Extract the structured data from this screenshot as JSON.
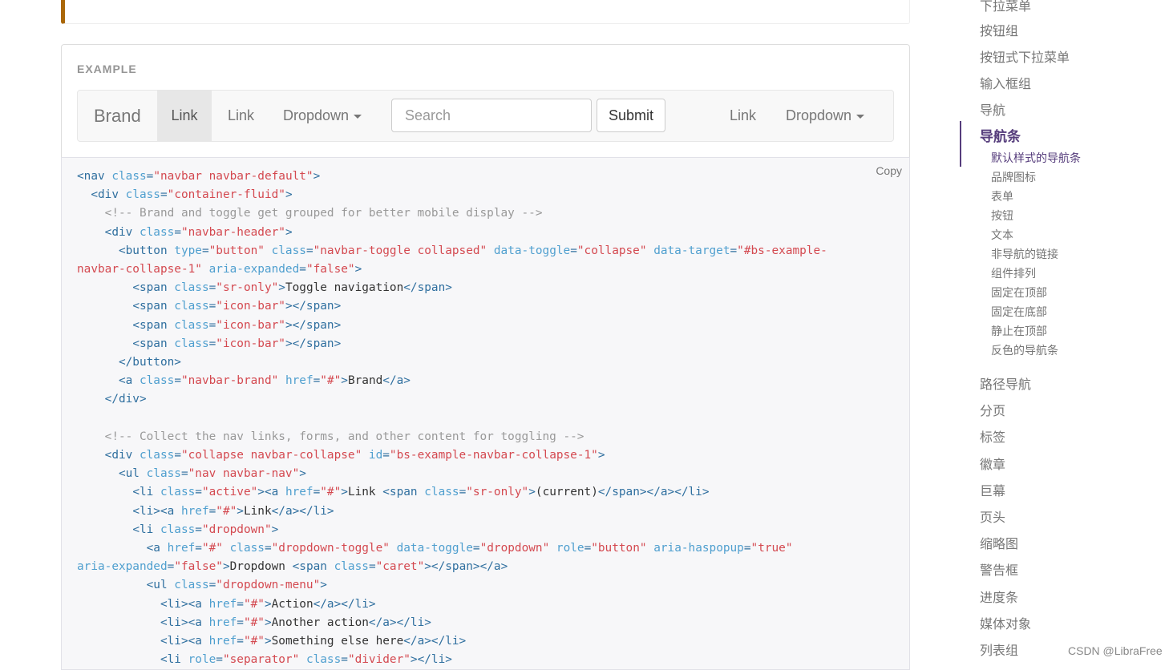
{
  "example": {
    "label": "EXAMPLE",
    "navbar": {
      "brand": "Brand",
      "active_link": "Link",
      "link": "Link",
      "dropdown": "Dropdown",
      "search_placeholder": "Search",
      "submit": "Submit",
      "right_link": "Link",
      "right_dropdown": "Dropdown"
    }
  },
  "code": {
    "copy_label": "Copy",
    "lines": [
      [
        [
          "t",
          "<nav "
        ],
        [
          "a",
          "class"
        ],
        [
          "t",
          "="
        ],
        [
          "s",
          "\"navbar navbar-default\""
        ],
        [
          "t",
          ">"
        ]
      ],
      [
        [
          "p",
          "  "
        ],
        [
          "t",
          "<div "
        ],
        [
          "a",
          "class"
        ],
        [
          "t",
          "="
        ],
        [
          "s",
          "\"container-fluid\""
        ],
        [
          "t",
          ">"
        ]
      ],
      [
        [
          "p",
          "    "
        ],
        [
          "c",
          "<!-- Brand and toggle get grouped for better mobile display -->"
        ]
      ],
      [
        [
          "p",
          "    "
        ],
        [
          "t",
          "<div "
        ],
        [
          "a",
          "class"
        ],
        [
          "t",
          "="
        ],
        [
          "s",
          "\"navbar-header\""
        ],
        [
          "t",
          ">"
        ]
      ],
      [
        [
          "p",
          "      "
        ],
        [
          "t",
          "<button "
        ],
        [
          "a",
          "type"
        ],
        [
          "t",
          "="
        ],
        [
          "s",
          "\"button\""
        ],
        [
          "p",
          " "
        ],
        [
          "a",
          "class"
        ],
        [
          "t",
          "="
        ],
        [
          "s",
          "\"navbar-toggle collapsed\""
        ],
        [
          "p",
          " "
        ],
        [
          "a",
          "data-toggle"
        ],
        [
          "t",
          "="
        ],
        [
          "s",
          "\"collapse\""
        ],
        [
          "p",
          " "
        ],
        [
          "a",
          "data-target"
        ],
        [
          "t",
          "="
        ],
        [
          "s",
          "\"#bs-example-"
        ]
      ],
      [
        [
          "s",
          "navbar-collapse-1\""
        ],
        [
          "p",
          " "
        ],
        [
          "a",
          "aria-expanded"
        ],
        [
          "t",
          "="
        ],
        [
          "s",
          "\"false\""
        ],
        [
          "t",
          ">"
        ]
      ],
      [
        [
          "p",
          "        "
        ],
        [
          "t",
          "<span "
        ],
        [
          "a",
          "class"
        ],
        [
          "t",
          "="
        ],
        [
          "s",
          "\"sr-only\""
        ],
        [
          "t",
          ">"
        ],
        [
          "p",
          "Toggle navigation"
        ],
        [
          "t",
          "</span>"
        ]
      ],
      [
        [
          "p",
          "        "
        ],
        [
          "t",
          "<span "
        ],
        [
          "a",
          "class"
        ],
        [
          "t",
          "="
        ],
        [
          "s",
          "\"icon-bar\""
        ],
        [
          "t",
          "></span>"
        ]
      ],
      [
        [
          "p",
          "        "
        ],
        [
          "t",
          "<span "
        ],
        [
          "a",
          "class"
        ],
        [
          "t",
          "="
        ],
        [
          "s",
          "\"icon-bar\""
        ],
        [
          "t",
          "></span>"
        ]
      ],
      [
        [
          "p",
          "        "
        ],
        [
          "t",
          "<span "
        ],
        [
          "a",
          "class"
        ],
        [
          "t",
          "="
        ],
        [
          "s",
          "\"icon-bar\""
        ],
        [
          "t",
          "></span>"
        ]
      ],
      [
        [
          "p",
          "      "
        ],
        [
          "t",
          "</button>"
        ]
      ],
      [
        [
          "p",
          "      "
        ],
        [
          "t",
          "<a "
        ],
        [
          "a",
          "class"
        ],
        [
          "t",
          "="
        ],
        [
          "s",
          "\"navbar-brand\""
        ],
        [
          "p",
          " "
        ],
        [
          "a",
          "href"
        ],
        [
          "t",
          "="
        ],
        [
          "s",
          "\"#\""
        ],
        [
          "t",
          ">"
        ],
        [
          "p",
          "Brand"
        ],
        [
          "t",
          "</a>"
        ]
      ],
      [
        [
          "p",
          "    "
        ],
        [
          "t",
          "</div>"
        ]
      ],
      [
        [
          "p",
          ""
        ]
      ],
      [
        [
          "p",
          "    "
        ],
        [
          "c",
          "<!-- Collect the nav links, forms, and other content for toggling -->"
        ]
      ],
      [
        [
          "p",
          "    "
        ],
        [
          "t",
          "<div "
        ],
        [
          "a",
          "class"
        ],
        [
          "t",
          "="
        ],
        [
          "s",
          "\"collapse navbar-collapse\""
        ],
        [
          "p",
          " "
        ],
        [
          "a",
          "id"
        ],
        [
          "t",
          "="
        ],
        [
          "s",
          "\"bs-example-navbar-collapse-1\""
        ],
        [
          "t",
          ">"
        ]
      ],
      [
        [
          "p",
          "      "
        ],
        [
          "t",
          "<ul "
        ],
        [
          "a",
          "class"
        ],
        [
          "t",
          "="
        ],
        [
          "s",
          "\"nav navbar-nav\""
        ],
        [
          "t",
          ">"
        ]
      ],
      [
        [
          "p",
          "        "
        ],
        [
          "t",
          "<li "
        ],
        [
          "a",
          "class"
        ],
        [
          "t",
          "="
        ],
        [
          "s",
          "\"active\""
        ],
        [
          "t",
          "><a "
        ],
        [
          "a",
          "href"
        ],
        [
          "t",
          "="
        ],
        [
          "s",
          "\"#\""
        ],
        [
          "t",
          ">"
        ],
        [
          "p",
          "Link "
        ],
        [
          "t",
          "<span "
        ],
        [
          "a",
          "class"
        ],
        [
          "t",
          "="
        ],
        [
          "s",
          "\"sr-only\""
        ],
        [
          "t",
          ">"
        ],
        [
          "p",
          "(current)"
        ],
        [
          "t",
          "</span></a></li>"
        ]
      ],
      [
        [
          "p",
          "        "
        ],
        [
          "t",
          "<li><a "
        ],
        [
          "a",
          "href"
        ],
        [
          "t",
          "="
        ],
        [
          "s",
          "\"#\""
        ],
        [
          "t",
          ">"
        ],
        [
          "p",
          "Link"
        ],
        [
          "t",
          "</a></li>"
        ]
      ],
      [
        [
          "p",
          "        "
        ],
        [
          "t",
          "<li "
        ],
        [
          "a",
          "class"
        ],
        [
          "t",
          "="
        ],
        [
          "s",
          "\"dropdown\""
        ],
        [
          "t",
          ">"
        ]
      ],
      [
        [
          "p",
          "          "
        ],
        [
          "t",
          "<a "
        ],
        [
          "a",
          "href"
        ],
        [
          "t",
          "="
        ],
        [
          "s",
          "\"#\""
        ],
        [
          "p",
          " "
        ],
        [
          "a",
          "class"
        ],
        [
          "t",
          "="
        ],
        [
          "s",
          "\"dropdown-toggle\""
        ],
        [
          "p",
          " "
        ],
        [
          "a",
          "data-toggle"
        ],
        [
          "t",
          "="
        ],
        [
          "s",
          "\"dropdown\""
        ],
        [
          "p",
          " "
        ],
        [
          "a",
          "role"
        ],
        [
          "t",
          "="
        ],
        [
          "s",
          "\"button\""
        ],
        [
          "p",
          " "
        ],
        [
          "a",
          "aria-haspopup"
        ],
        [
          "t",
          "="
        ],
        [
          "s",
          "\"true\""
        ]
      ],
      [
        [
          "a",
          "aria-expanded"
        ],
        [
          "t",
          "="
        ],
        [
          "s",
          "\"false\""
        ],
        [
          "t",
          ">"
        ],
        [
          "p",
          "Dropdown "
        ],
        [
          "t",
          "<span "
        ],
        [
          "a",
          "class"
        ],
        [
          "t",
          "="
        ],
        [
          "s",
          "\"caret\""
        ],
        [
          "t",
          "></span></a>"
        ]
      ],
      [
        [
          "p",
          "          "
        ],
        [
          "t",
          "<ul "
        ],
        [
          "a",
          "class"
        ],
        [
          "t",
          "="
        ],
        [
          "s",
          "\"dropdown-menu\""
        ],
        [
          "t",
          ">"
        ]
      ],
      [
        [
          "p",
          "            "
        ],
        [
          "t",
          "<li><a "
        ],
        [
          "a",
          "href"
        ],
        [
          "t",
          "="
        ],
        [
          "s",
          "\"#\""
        ],
        [
          "t",
          ">"
        ],
        [
          "p",
          "Action"
        ],
        [
          "t",
          "</a></li>"
        ]
      ],
      [
        [
          "p",
          "            "
        ],
        [
          "t",
          "<li><a "
        ],
        [
          "a",
          "href"
        ],
        [
          "t",
          "="
        ],
        [
          "s",
          "\"#\""
        ],
        [
          "t",
          ">"
        ],
        [
          "p",
          "Another action"
        ],
        [
          "t",
          "</a></li>"
        ]
      ],
      [
        [
          "p",
          "            "
        ],
        [
          "t",
          "<li><a "
        ],
        [
          "a",
          "href"
        ],
        [
          "t",
          "="
        ],
        [
          "s",
          "\"#\""
        ],
        [
          "t",
          ">"
        ],
        [
          "p",
          "Something else here"
        ],
        [
          "t",
          "</a></li>"
        ]
      ],
      [
        [
          "p",
          "            "
        ],
        [
          "t",
          "<li "
        ],
        [
          "a",
          "role"
        ],
        [
          "t",
          "="
        ],
        [
          "s",
          "\"separator\""
        ],
        [
          "p",
          " "
        ],
        [
          "a",
          "class"
        ],
        [
          "t",
          "="
        ],
        [
          "s",
          "\"divider\""
        ],
        [
          "t",
          "></li>"
        ]
      ]
    ]
  },
  "sidebar": {
    "items_top": [
      "下拉菜单",
      "按钮组",
      "按钮式下拉菜单",
      "输入框组",
      "导航"
    ],
    "active": "导航条",
    "sub": [
      "默认样式的导航条",
      "品牌图标",
      "表单",
      "按钮",
      "文本",
      "非导航的链接",
      "组件排列",
      "固定在顶部",
      "固定在底部",
      "静止在顶部",
      "反色的导航条"
    ],
    "items_bottom": [
      "路径导航",
      "分页",
      "标签",
      "徽章",
      "巨幕",
      "页头",
      "缩略图",
      "警告框",
      "进度条",
      "媒体对象",
      "列表组"
    ]
  },
  "watermark": "CSDN @LibraFree"
}
